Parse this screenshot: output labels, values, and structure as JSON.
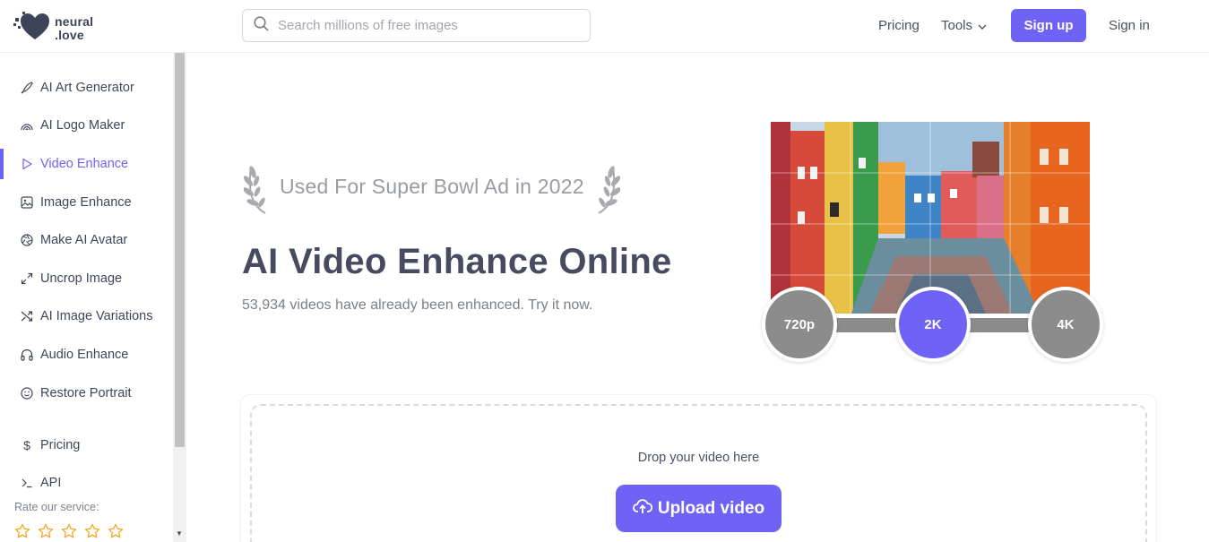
{
  "brand": {
    "line1": "neural",
    "line2": ".love",
    "accent": "#6f63f5"
  },
  "search": {
    "placeholder": "Search millions of free images",
    "value": ""
  },
  "nav": {
    "pricing": "Pricing",
    "tools": "Tools",
    "signup": "Sign up",
    "signin": "Sign in"
  },
  "sidebar": {
    "items": [
      {
        "label": "AI Art Generator",
        "icon": "brush-icon"
      },
      {
        "label": "AI Logo Maker",
        "icon": "rainbow-icon"
      },
      {
        "label": "Video Enhance",
        "icon": "play-icon",
        "active": true
      },
      {
        "label": "Image Enhance",
        "icon": "image-icon"
      },
      {
        "label": "Make AI Avatar",
        "icon": "aperture-icon"
      },
      {
        "label": "Uncrop Image",
        "icon": "expand-icon"
      },
      {
        "label": "AI Image Variations",
        "icon": "shuffle-icon"
      },
      {
        "label": "Audio Enhance",
        "icon": "headphones-icon"
      },
      {
        "label": "Restore Portrait",
        "icon": "smile-icon"
      }
    ],
    "secondary": [
      {
        "label": "Pricing",
        "icon": "dollar-icon"
      },
      {
        "label": "API",
        "icon": "terminal-icon"
      }
    ],
    "rate_label": "Rate our service:",
    "star_color": "#f5a623"
  },
  "hero": {
    "badge": "Used For Super Bowl Ad in 2022",
    "title": "AI Video Enhance Online",
    "subtitle": "53,934 videos have already been enhanced. Try it now.",
    "resolutions": [
      "720p",
      "2K",
      "4K"
    ],
    "selected_resolution": "2K"
  },
  "upload": {
    "drop_text": "Drop your video here",
    "button": "Upload video"
  }
}
